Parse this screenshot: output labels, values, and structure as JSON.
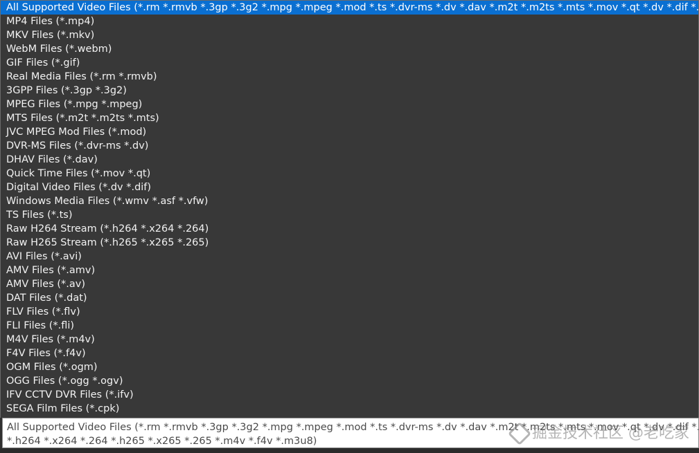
{
  "filter_dropdown": {
    "options": [
      "All Supported Video Files (*.rm *.rmvb *.3gp *.3g2 *.mpg *.mpeg *.mod *.ts *.dvr-ms *.dv *.dav *.m2t *.m2ts *.mts *.mov *.qt *.dv *.dif *.wm",
      "MP4 Files (*.mp4)",
      "MKV Files (*.mkv)",
      "WebM Files (*.webm)",
      "GIF Files (*.gif)",
      "Real Media Files (*.rm *.rmvb)",
      "3GPP Files (*.3gp *.3g2)",
      "MPEG Files (*.mpg *.mpeg)",
      "MTS Files (*.m2t *.m2ts *.mts)",
      "JVC MPEG Mod Files (*.mod)",
      "DVR-MS Files (*.dvr-ms *.dv)",
      "DHAV Files (*.dav)",
      "Quick Time Files (*.mov *.qt)",
      "Digital Video Files (*.dv *.dif)",
      "Windows Media Files (*.wmv *.asf *.vfw)",
      "TS Files (*.ts)",
      "Raw H264 Stream (*.h264 *.x264 *.264)",
      "Raw H265 Stream (*.h265 *.x265 *.265)",
      "AVI Files (*.avi)",
      "AMV Files (*.amv)",
      "AMV Files (*.av)",
      "DAT Files (*.dat)",
      "FLV Files (*.flv)",
      "FLI Files (*.fli)",
      "M4V Files (*.m4v)",
      "F4V Files (*.f4v)",
      "OGM Files (*.ogm)",
      "OGG Files (*.ogg *.ogv)",
      "IFV CCTV DVR Files (*.ifv)",
      "SEGA Film Files (*.cpk)"
    ],
    "selected_index": 0
  },
  "tooltip": {
    "line1": "All Supported Video Files (*.rm *.rmvb *.3gp *.3g2 *.mpg *.mpeg *.mod *.ts *.dvr-ms *.dv *.dav *.m2t *.m2ts *.mts *.mov *.qt *.dv *.dif *.wm",
    "line2": "*.h264 *.x264 *.264 *.h265 *.x265 *.265 *.m4v *.f4v *.m3u8)"
  },
  "watermark": {
    "text": "掘金技术社区 @老吃家"
  },
  "colors": {
    "list_background": "#383838",
    "selected_background": "#0a6fd1",
    "list_text": "#f2f2f2",
    "tooltip_background": "#ffffff"
  }
}
